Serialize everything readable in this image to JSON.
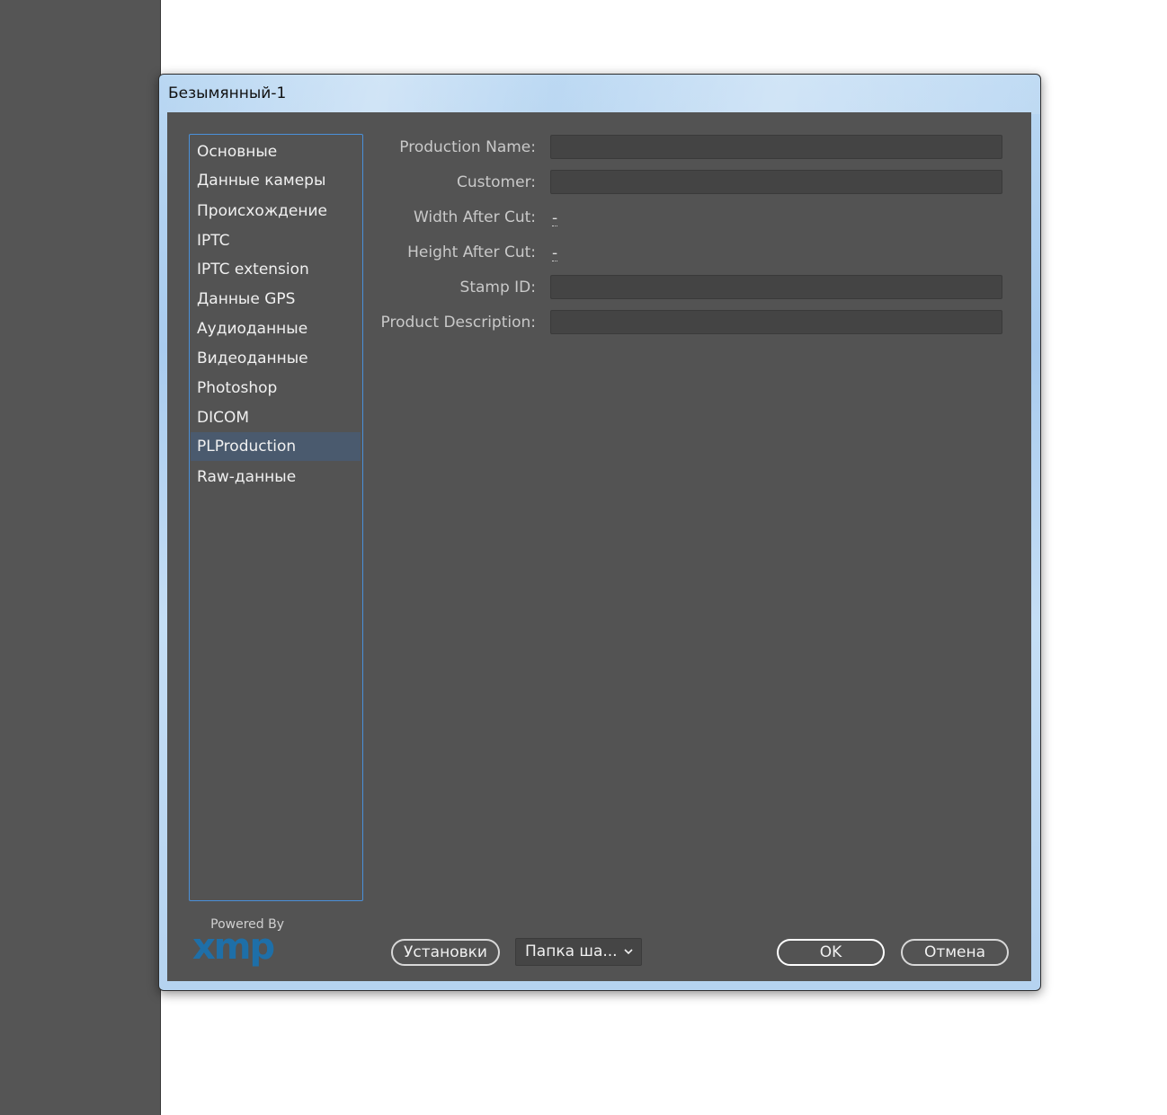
{
  "window": {
    "title": "Безымянный-1"
  },
  "categories": [
    {
      "label": "Основные",
      "selected": false
    },
    {
      "label": "Данные камеры",
      "selected": false
    },
    {
      "label": "Происхождение",
      "selected": false
    },
    {
      "label": "IPTC",
      "selected": false
    },
    {
      "label": "IPTC extension",
      "selected": false
    },
    {
      "label": "Данные GPS",
      "selected": false
    },
    {
      "label": "Аудиоданные",
      "selected": false
    },
    {
      "label": "Видеоданные",
      "selected": false
    },
    {
      "label": "Photoshop",
      "selected": false
    },
    {
      "label": "DICOM",
      "selected": false
    },
    {
      "label": "PLProduction",
      "selected": true
    },
    {
      "label": "Raw-данные",
      "selected": false
    }
  ],
  "fields": {
    "production_name": {
      "label": "Production Name:",
      "value": ""
    },
    "customer": {
      "label": "Customer:",
      "value": ""
    },
    "width_after_cut": {
      "label": "Width After Cut:",
      "value": "-"
    },
    "height_after_cut": {
      "label": "Height After Cut:",
      "value": "-"
    },
    "stamp_id": {
      "label": "Stamp ID:",
      "value": ""
    },
    "product_description": {
      "label": "Product Description:",
      "value": ""
    }
  },
  "footer": {
    "powered_by": "Powered By",
    "logo_text": "xmp",
    "settings_button": "Установки",
    "template_folder": "Папка ша...",
    "ok_button": "OK",
    "cancel_button": "Отмена"
  },
  "colors": {
    "panel_background": "#535353",
    "list_border": "#4a90d9",
    "selected_item": "#4a5a6e",
    "xmp_logo": "#1e6fa8"
  }
}
